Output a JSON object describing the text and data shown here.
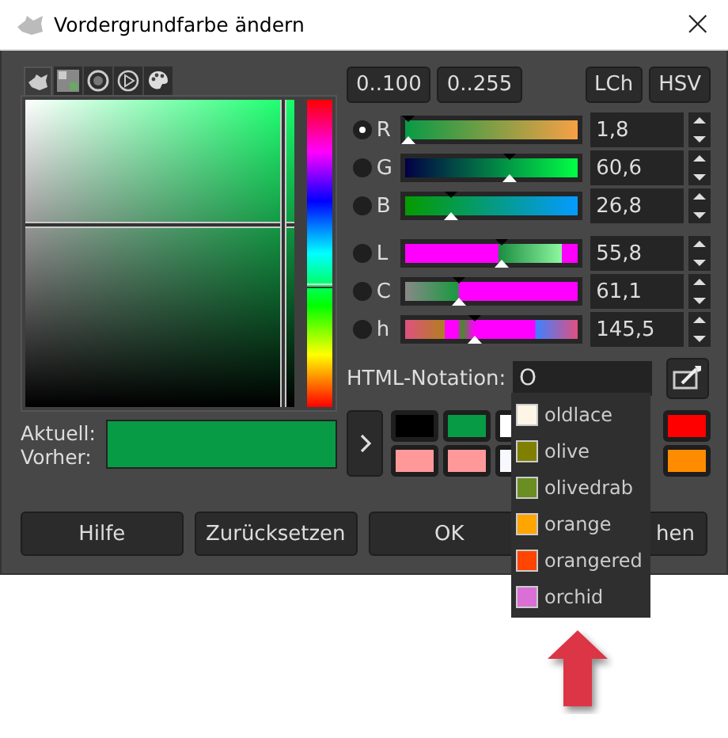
{
  "window": {
    "title": "Vordergrundfarbe ändern",
    "close": "×"
  },
  "picker_tabs": [
    {
      "kind": "mascot",
      "selected": true
    },
    {
      "kind": "cmyk",
      "selected": false
    },
    {
      "kind": "circle",
      "selected": false
    },
    {
      "kind": "play",
      "selected": false
    },
    {
      "kind": "palette",
      "selected": false
    }
  ],
  "range_buttons": [
    "0..100",
    "0..255"
  ],
  "model_buttons": [
    "LCh",
    "HSV"
  ],
  "sliders": [
    {
      "label": "R",
      "value": "1,8",
      "level": 0.018,
      "selected": true
    },
    {
      "label": "G",
      "value": "60,6",
      "level": 0.606,
      "selected": false
    },
    {
      "label": "B",
      "value": "26,8",
      "level": 0.268,
      "selected": false
    },
    {
      "label": "L",
      "value": "55,8",
      "level": 0.558,
      "selected": false
    },
    {
      "label": "C",
      "value": "61,1",
      "level": 0.31,
      "selected": false
    },
    {
      "label": "h",
      "value": "145,5",
      "level": 0.404,
      "selected": false
    }
  ],
  "current": {
    "label": "Aktuell:",
    "color": "#079b45"
  },
  "previous": {
    "label": "Vorher:",
    "color": "#079b45"
  },
  "html_notation": {
    "label": "HTML-Notation:",
    "value": "O"
  },
  "swatches_left": [
    [
      {
        "color": "#000000"
      },
      {
        "color": "#079b45"
      },
      {
        "color": "#ffffff"
      }
    ],
    [
      {
        "color": "#ff9999"
      },
      {
        "color": "#ff9999"
      },
      {
        "color": "#f8f8ff"
      }
    ]
  ],
  "swatches_right": [
    [
      {
        "color": "#ff0000"
      }
    ],
    [
      {
        "color": "#ff8c00"
      }
    ]
  ],
  "suggestions": [
    {
      "name": "oldlace",
      "color": "#fdf5e6"
    },
    {
      "name": "olive",
      "color": "#808000"
    },
    {
      "name": "olivedrab",
      "color": "#6b8e23"
    },
    {
      "name": "orange",
      "color": "#ffa500"
    },
    {
      "name": "orangered",
      "color": "#ff4500"
    },
    {
      "name": "orchid",
      "color": "#da70d6"
    }
  ],
  "buttons": [
    "Hilfe",
    "Zurücksetzen",
    "OK",
    "hen"
  ]
}
